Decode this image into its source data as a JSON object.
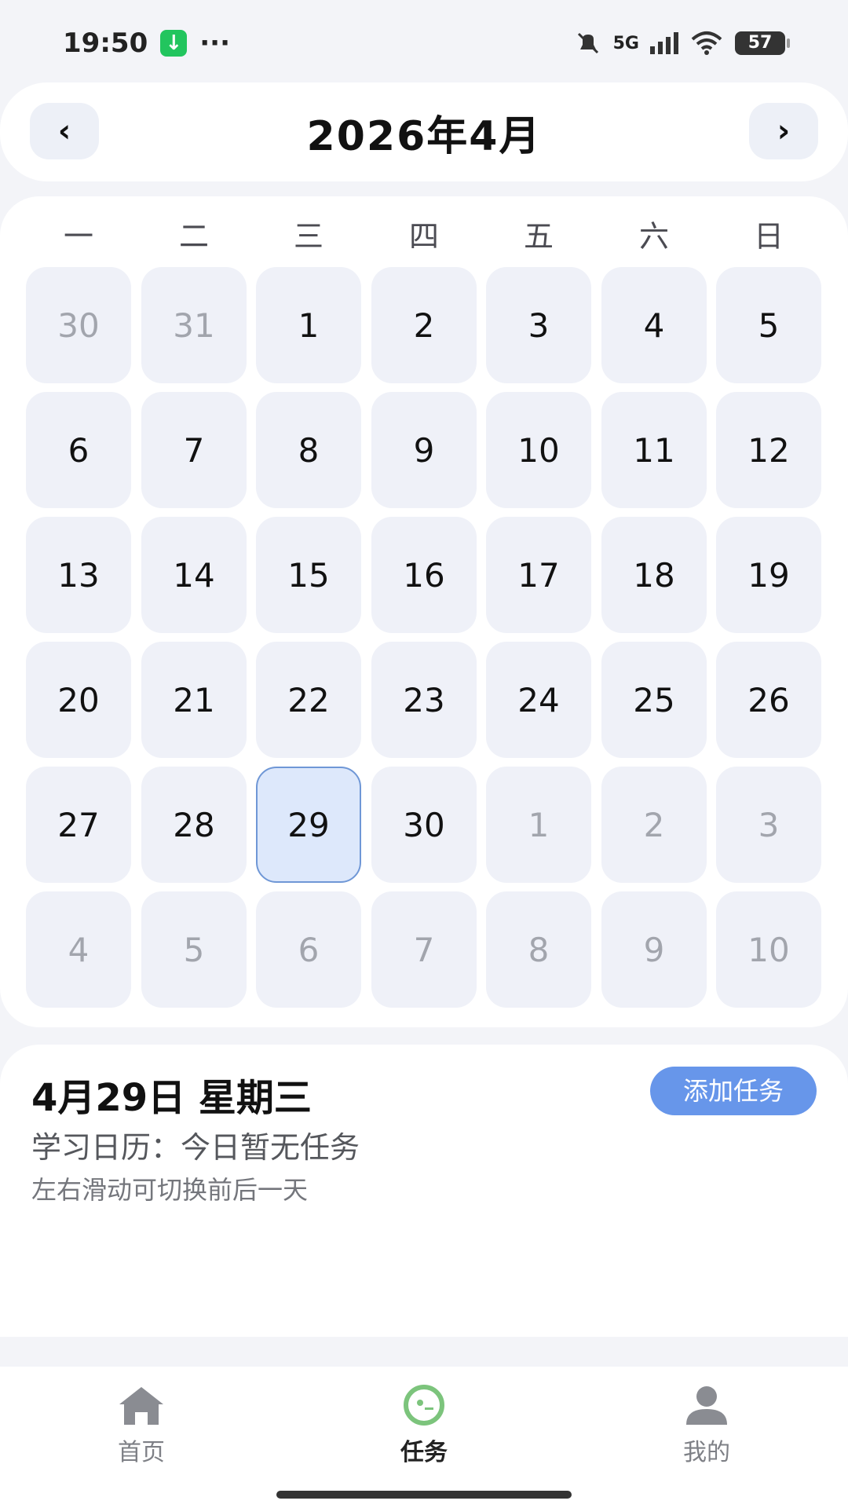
{
  "status_bar": {
    "time": "19:50",
    "more": "···",
    "network": "5G",
    "battery": "57"
  },
  "header": {
    "title": "2026年4月",
    "prev_label": "‹",
    "next_label": "›"
  },
  "weekdays": [
    "一",
    "二",
    "三",
    "四",
    "五",
    "六",
    "日"
  ],
  "days": [
    "30",
    "31",
    "1",
    "2",
    "3",
    "4",
    "5",
    "6",
    "7",
    "8",
    "9",
    "10",
    "11",
    "12",
    "13",
    "14",
    "15",
    "16",
    "17",
    "18",
    "19",
    "20",
    "21",
    "22",
    "23",
    "24",
    "25",
    "26",
    "27",
    "28",
    "29",
    "30",
    "1",
    "2",
    "3",
    "4",
    "5",
    "6",
    "7",
    "8",
    "9",
    "10"
  ],
  "selected_day": "29",
  "detail": {
    "date": "4月29日 星期三",
    "status": "学习日历：今日暂无任务",
    "hint": "左右滑动可切换前后一天",
    "add_button": "添加任务"
  },
  "bottom_nav": {
    "home": "首页",
    "tasks": "任务",
    "mine": "我的",
    "active_color": "#7cc47c",
    "inactive_color": "#8a8c92"
  },
  "colors": {
    "accent": "#6796ea",
    "selected_border": "#6f97d6"
  },
  "icons": {
    "download": "download-icon",
    "mute": "mute-icon",
    "wifi": "wifi-icon",
    "home": "home-icon",
    "tasks": "tasks-icon",
    "mine": "user-icon"
  }
}
